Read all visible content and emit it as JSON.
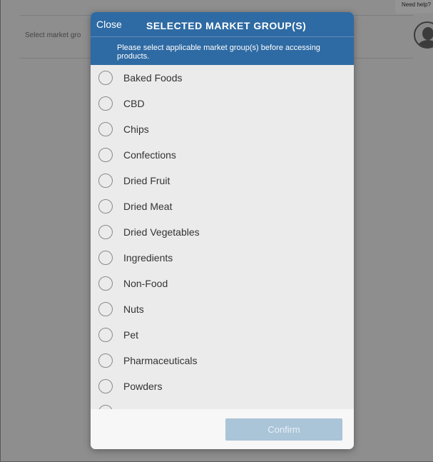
{
  "background": {
    "select_label": "Select market gro",
    "help_label": "Need help?"
  },
  "modal": {
    "close_label": "Close",
    "title": "SELECTED MARKET GROUP(S)",
    "subtitle": "Please select applicable market group(s) before accessing products.",
    "options": [
      {
        "label": "Baked Foods",
        "selected": false
      },
      {
        "label": "CBD",
        "selected": false
      },
      {
        "label": "Chips",
        "selected": false
      },
      {
        "label": "Confections",
        "selected": false
      },
      {
        "label": "Dried Fruit",
        "selected": false
      },
      {
        "label": "Dried Meat",
        "selected": false
      },
      {
        "label": "Dried Vegetables",
        "selected": false
      },
      {
        "label": "Ingredients",
        "selected": false
      },
      {
        "label": "Non-Food",
        "selected": false
      },
      {
        "label": "Nuts",
        "selected": false
      },
      {
        "label": "Pet",
        "selected": false
      },
      {
        "label": "Pharmaceuticals",
        "selected": false
      },
      {
        "label": "Powders",
        "selected": false
      }
    ],
    "confirm_label": "Confirm"
  },
  "colors": {
    "header": "#2e6aa3",
    "confirm_disabled": "#aac4d8"
  }
}
